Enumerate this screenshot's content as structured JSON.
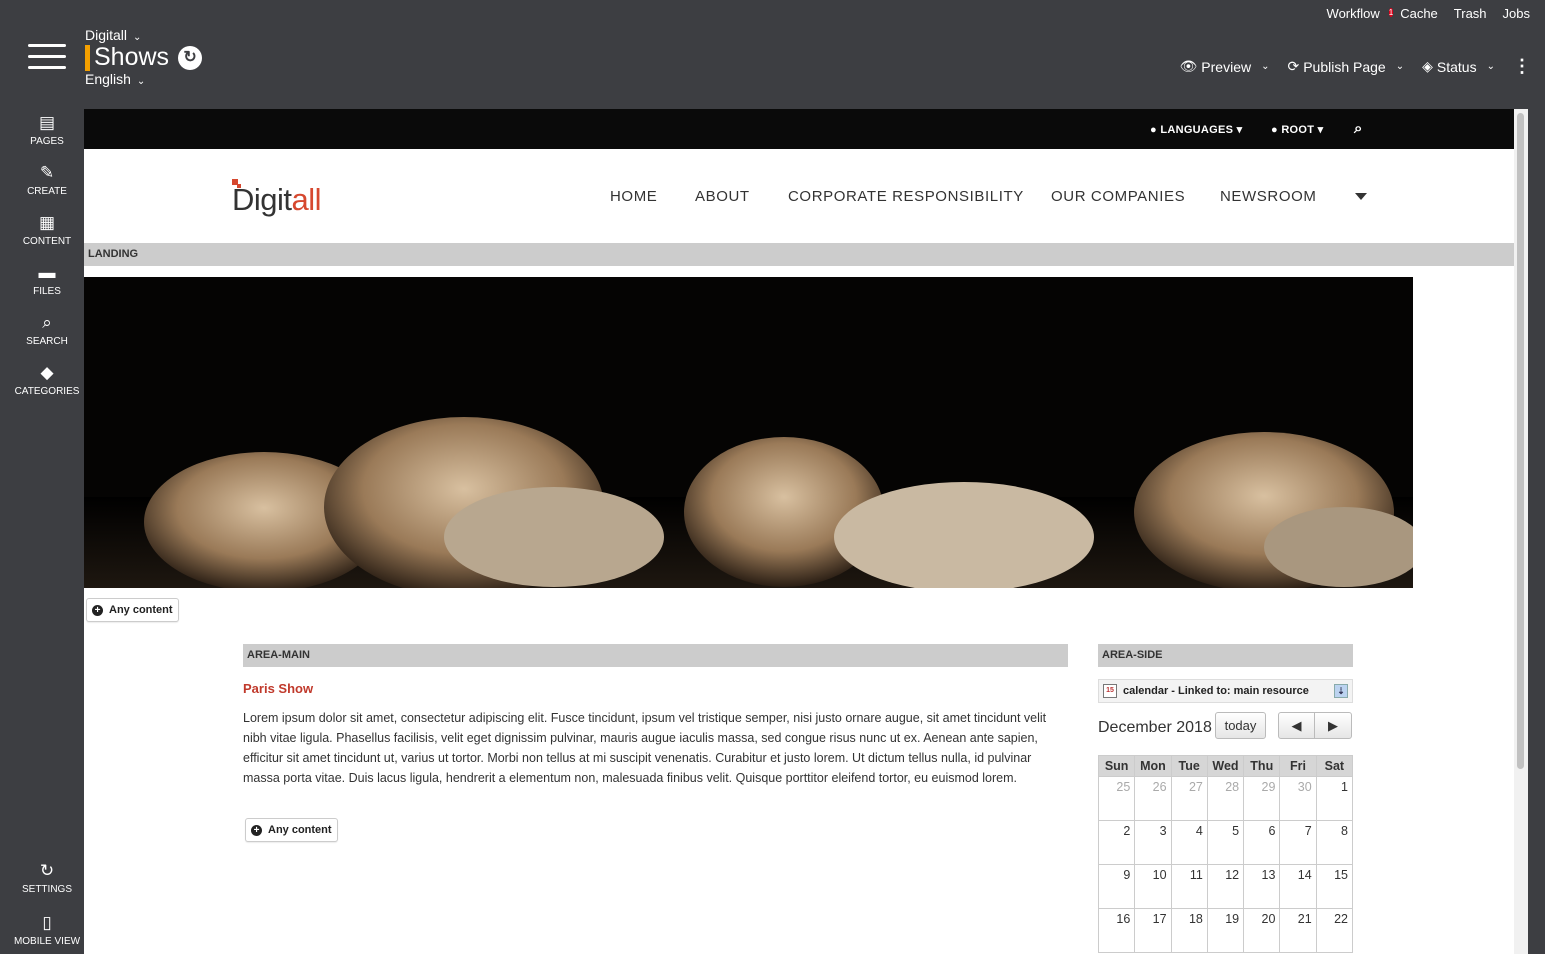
{
  "top_links": {
    "workflow": "Workflow",
    "workflow_badge": "1",
    "cache": "Cache",
    "trash": "Trash",
    "jobs": "Jobs"
  },
  "header": {
    "site": "Digitall",
    "page": "Shows",
    "language": "English"
  },
  "actions": {
    "preview": "Preview",
    "publish": "Publish Page",
    "status": "Status"
  },
  "sidebar": {
    "pages": "PAGES",
    "create": "CREATE",
    "content": "CONTENT",
    "files": "FILES",
    "search": "SEARCH",
    "categories": "CATEGORIES",
    "settings": "SETTINGS",
    "mobile_view": "MOBILE VIEW"
  },
  "site_top": {
    "languages": "LANGUAGES",
    "root": "ROOT"
  },
  "logo": {
    "part1": "Digit",
    "part2": "all"
  },
  "nav": {
    "home": "HOME",
    "about": "ABOUT",
    "corporate": "CORPORATE RESPONSIBILITY",
    "companies": "OUR COMPANIES",
    "newsroom": "NEWSROOM"
  },
  "areas": {
    "landing": "LANDING",
    "main": "AREA-MAIN",
    "side": "AREA-SIDE"
  },
  "buttons": {
    "any_content": "Any content"
  },
  "article": {
    "title": "Paris Show",
    "body": "Lorem ipsum dolor sit amet, consectetur adipiscing elit. Fusce tincidunt, ipsum vel tristique semper, nisi justo ornare augue, sit amet tincidunt velit nibh vitae ligula. Phasellus facilisis, velit eget dignissim pulvinar, mauris augue iaculis massa, sed congue risus nunc ut ex. Aenean ante sapien, efficitur sit amet tincidunt ut, varius ut tortor. Morbi non tellus at mi suscipit venenatis. Curabitur et justo lorem. Ut dictum tellus nulla, id pulvinar massa porta vitae. Duis lacus ligula, hendrerit a elementum non, malesuada finibus velit. Quisque porttitor eleifend tortor, eu euismod lorem."
  },
  "calendar": {
    "header": "calendar - Linked to: main resource",
    "icon_day": "15",
    "month": "December 2018",
    "today": "today",
    "prev": "◀",
    "next": "▶",
    "days": [
      "Sun",
      "Mon",
      "Tue",
      "Wed",
      "Thu",
      "Fri",
      "Sat"
    ],
    "weeks": [
      [
        {
          "d": "25",
          "o": true
        },
        {
          "d": "26",
          "o": true
        },
        {
          "d": "27",
          "o": true
        },
        {
          "d": "28",
          "o": true
        },
        {
          "d": "29",
          "o": true
        },
        {
          "d": "30",
          "o": true
        },
        {
          "d": "1",
          "o": false
        }
      ],
      [
        {
          "d": "2",
          "o": false
        },
        {
          "d": "3",
          "o": false
        },
        {
          "d": "4",
          "o": false
        },
        {
          "d": "5",
          "o": false
        },
        {
          "d": "6",
          "o": false
        },
        {
          "d": "7",
          "o": false
        },
        {
          "d": "8",
          "o": false
        }
      ],
      [
        {
          "d": "9",
          "o": false
        },
        {
          "d": "10",
          "o": false
        },
        {
          "d": "11",
          "o": false
        },
        {
          "d": "12",
          "o": false
        },
        {
          "d": "13",
          "o": false
        },
        {
          "d": "14",
          "o": false
        },
        {
          "d": "15",
          "o": false
        }
      ],
      [
        {
          "d": "16",
          "o": false
        },
        {
          "d": "17",
          "o": false
        },
        {
          "d": "18",
          "o": false
        },
        {
          "d": "19",
          "o": false
        },
        {
          "d": "20",
          "o": false
        },
        {
          "d": "21",
          "o": false
        },
        {
          "d": "22",
          "o": false
        }
      ]
    ]
  },
  "colors": {
    "chrome": "#3d3e42",
    "accent": "#f5a000",
    "brand_red": "#d6482f",
    "badge": "#e0001a"
  }
}
